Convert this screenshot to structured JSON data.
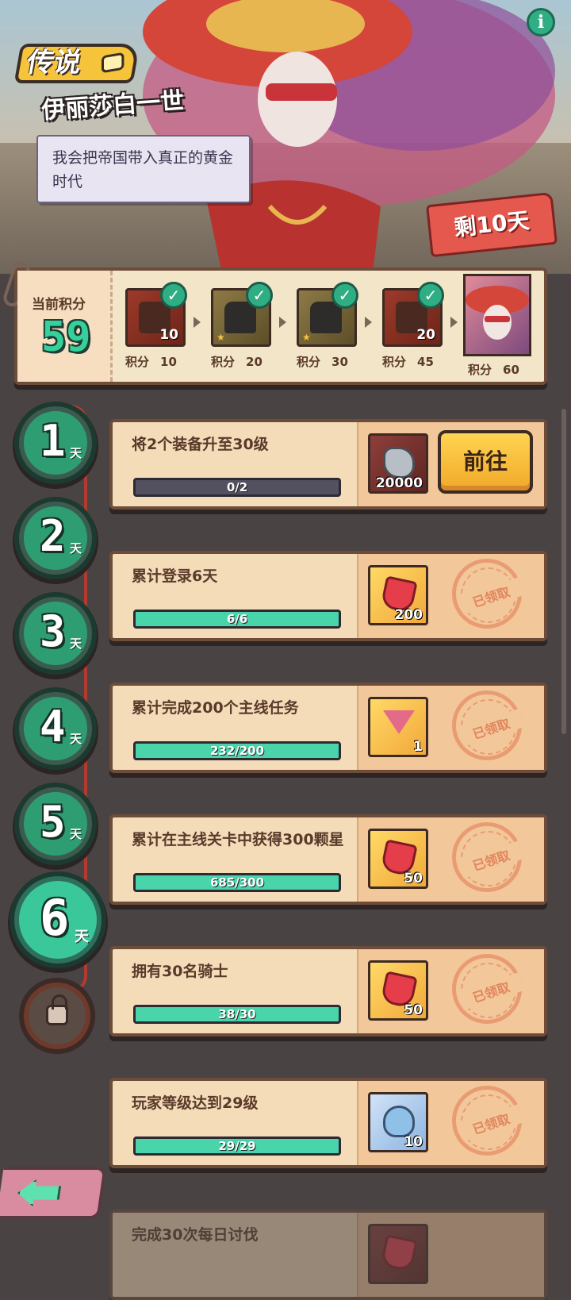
{
  "hero": {
    "rarity": "传说",
    "name": "伊丽莎白一世",
    "quote": "我会把帝国带入真正的黄金时代",
    "days_left": "剩10天",
    "info_icon": "i"
  },
  "score": {
    "label": "当前积分",
    "value": "59",
    "milestones": [
      {
        "qty": "10",
        "pts_label": "积分",
        "pts": "10",
        "claimed": true,
        "kind": "red"
      },
      {
        "qty": "",
        "pts_label": "积分",
        "pts": "20",
        "claimed": true,
        "kind": "olive"
      },
      {
        "qty": "",
        "pts_label": "积分",
        "pts": "30",
        "claimed": true,
        "kind": "olive"
      },
      {
        "qty": "20",
        "pts_label": "积分",
        "pts": "45",
        "claimed": true,
        "kind": "red"
      },
      {
        "qty": "",
        "pts_label": "积分",
        "pts": "60",
        "claimed": false,
        "kind": "portrait"
      }
    ]
  },
  "days": [
    {
      "num": "1",
      "unit": "天"
    },
    {
      "num": "2",
      "unit": "天"
    },
    {
      "num": "3",
      "unit": "天"
    },
    {
      "num": "4",
      "unit": "天"
    },
    {
      "num": "5",
      "unit": "天"
    },
    {
      "num": "6",
      "unit": "天",
      "active": true
    }
  ],
  "tasks": [
    {
      "title": "将2个装备升至30级",
      "progress_text": "0/2",
      "progress": 0.0,
      "reward_qty": "20000",
      "reward_icon": "stone-icon",
      "reward_bg": "maroon",
      "action": "前往",
      "claimed": false
    },
    {
      "title": "累计登录6天",
      "progress_text": "6/6",
      "progress": 1.0,
      "reward_qty": "200",
      "reward_icon": "gem-icon",
      "reward_bg": "gold",
      "claimed": true
    },
    {
      "title": "累计完成200个主线任务",
      "progress_text": "232/200",
      "progress": 1.0,
      "reward_qty": "1",
      "reward_icon": "drink-icon",
      "reward_bg": "gold",
      "claimed": true
    },
    {
      "title": "累计在主线关卡中获得300颗星",
      "progress_text": "685/300",
      "progress": 1.0,
      "reward_qty": "50",
      "reward_icon": "gem-icon",
      "reward_bg": "gold",
      "claimed": true
    },
    {
      "title": "拥有30名骑士",
      "progress_text": "38/30",
      "progress": 1.0,
      "reward_qty": "50",
      "reward_icon": "gem-icon",
      "reward_bg": "gold",
      "claimed": true
    },
    {
      "title": "玩家等级达到29级",
      "progress_text": "29/29",
      "progress": 1.0,
      "reward_qty": "10",
      "reward_icon": "potion-icon",
      "reward_bg": "blue",
      "claimed": true
    },
    {
      "title": "完成30次每日讨伐",
      "progress_text": "",
      "progress": 0.0,
      "reward_qty": "",
      "reward_icon": "gem-icon",
      "reward_bg": "maroon",
      "claimed": false
    }
  ],
  "claimed_stamp": "已领取",
  "colors": {
    "accent_green": "#35d19a",
    "go_button": "#ffd452",
    "panel": "#f4dcb9"
  }
}
